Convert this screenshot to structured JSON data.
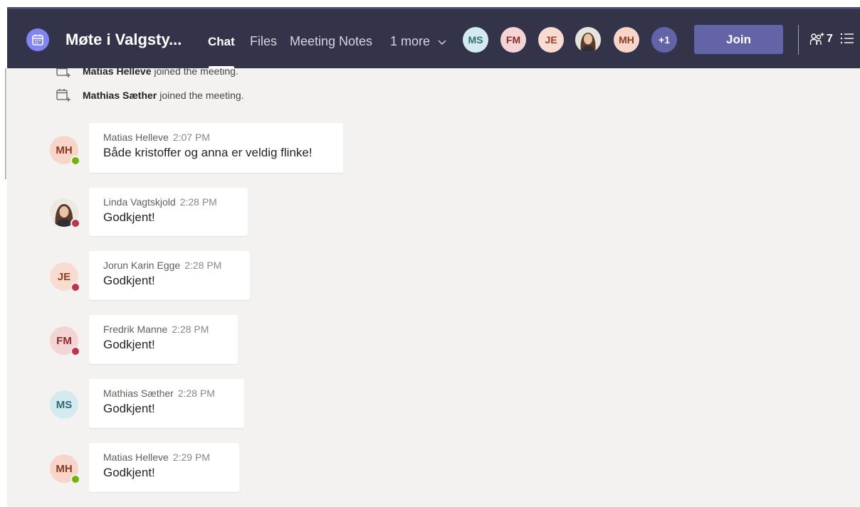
{
  "header": {
    "title": "Møte i Valgsty...",
    "tabs": [
      {
        "label": "Chat",
        "active": true
      },
      {
        "label": "Files"
      },
      {
        "label": "Meeting Notes"
      },
      {
        "label": "1 more"
      }
    ],
    "participants": [
      {
        "initials": "MS",
        "bg": "#d3ebee",
        "fg": "#2e6b74"
      },
      {
        "initials": "FM",
        "bg": "#f4d5d5",
        "fg": "#8b2b2b"
      },
      {
        "initials": "JE",
        "bg": "#f9dcd0",
        "fg": "#9a3f25"
      },
      {
        "initials": "",
        "photo": true
      },
      {
        "initials": "MH",
        "bg": "#f7d6c9",
        "fg": "#8a3a1f"
      },
      {
        "initials": "+1",
        "bg": "#6264a7",
        "fg": "#ffffff"
      }
    ],
    "join_label": "Join",
    "people_count": "7",
    "accent": "#6264a7",
    "bar_color": "#33344a"
  },
  "system_messages": [
    {
      "name": "Matias Helleve",
      "text": "joined the meeting."
    },
    {
      "name": "Mathias Sæther",
      "text": "joined the meeting."
    }
  ],
  "messages": [
    {
      "initials": "MH",
      "status": "available",
      "author": "Matias Helleve",
      "time": "2:07 PM",
      "text": "Både kristoffer og anna er veldig flinke!"
    },
    {
      "initials": "",
      "photo": true,
      "status": "busy",
      "author": "Linda Vagtskjold",
      "time": "2:28 PM",
      "text": "Godkjent!"
    },
    {
      "initials": "JE",
      "status": "busy",
      "author": "Jorun Karin Egge",
      "time": "2:28 PM",
      "text": "Godkjent!"
    },
    {
      "initials": "FM",
      "status": "busy",
      "author": "Fredrik Manne",
      "time": "2:28 PM",
      "text": "Godkjent!"
    },
    {
      "initials": "MS",
      "status": "none",
      "author": "Mathias Sæther",
      "time": "2:28 PM",
      "text": "Godkjent!"
    },
    {
      "initials": "MH",
      "status": "available",
      "author": "Matias Helleve",
      "time": "2:29 PM",
      "text": "Godkjent!"
    }
  ],
  "status_colors": {
    "available": "#6bb700",
    "busy": "#c4314b"
  }
}
